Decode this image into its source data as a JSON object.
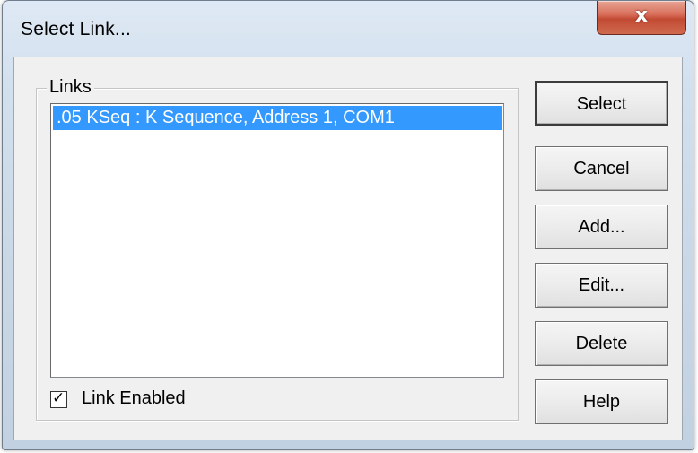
{
  "window": {
    "title": "Select Link...",
    "close_glyph": "x"
  },
  "links_group": {
    "label": "Links",
    "items": [
      {
        "text": ".05 KSeq : K Sequence, Address 1, COM1",
        "selected": true
      }
    ]
  },
  "link_enabled": {
    "label": "Link Enabled",
    "checked": true,
    "check_glyph": "✓"
  },
  "buttons": {
    "select": "Select",
    "cancel": "Cancel",
    "add": "Add...",
    "edit": "Edit...",
    "delete": "Delete",
    "help": "Help"
  },
  "colors": {
    "selection": "#3399ff",
    "close_button": "#c24a33"
  }
}
